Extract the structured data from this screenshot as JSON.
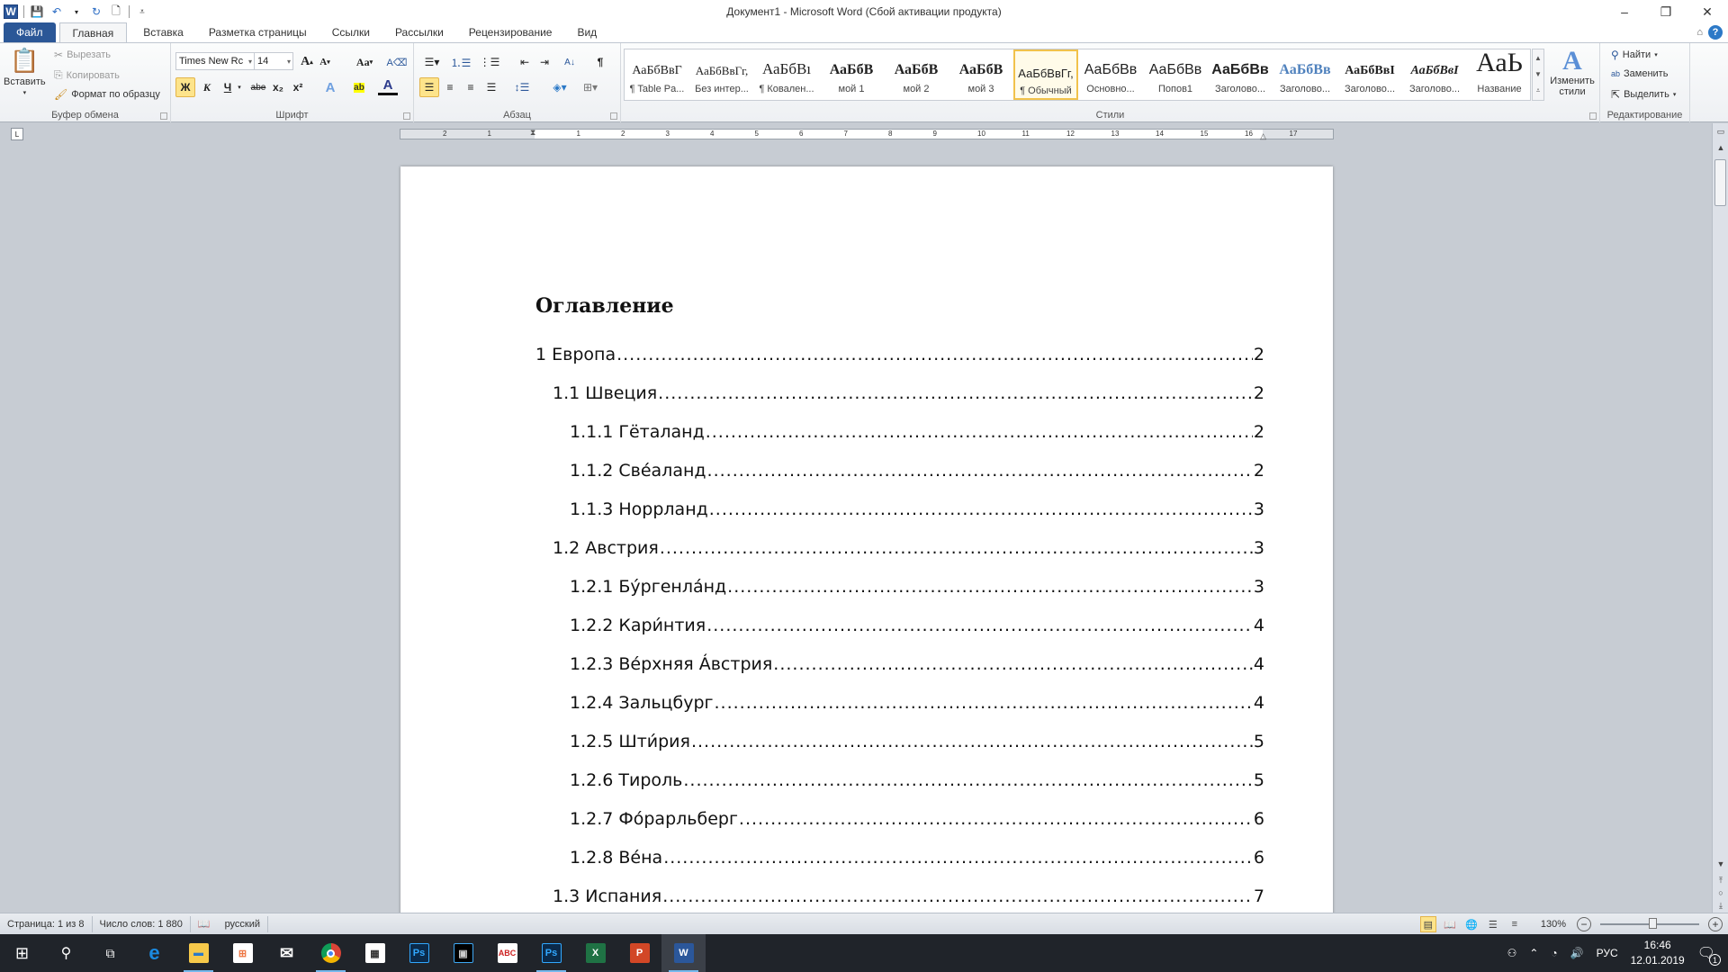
{
  "window": {
    "title": "Документ1 - Microsoft Word (Сбой активации продукта)",
    "controls": {
      "minimize": "–",
      "restore": "❐",
      "close": "✕"
    }
  },
  "qat": {
    "icons": [
      "word-logo",
      "save",
      "undo",
      "redo",
      "new-document",
      "customize"
    ]
  },
  "tabs": [
    {
      "label": "Файл",
      "active": false
    },
    {
      "label": "Главная",
      "active": true
    },
    {
      "label": "Вставка",
      "active": false
    },
    {
      "label": "Разметка страницы",
      "active": false
    },
    {
      "label": "Ссылки",
      "active": false
    },
    {
      "label": "Рассылки",
      "active": false
    },
    {
      "label": "Рецензирование",
      "active": false
    },
    {
      "label": "Вид",
      "active": false
    }
  ],
  "ribbon": {
    "clipboard": {
      "label": "Буфер обмена",
      "paste": "Вставить",
      "cut": "Вырезать",
      "copy": "Копировать",
      "format_painter": "Формат по образцу"
    },
    "font": {
      "label": "Шрифт",
      "font_name": "Times New Rc",
      "font_size": "14",
      "bold": "Ж",
      "italic": "К",
      "underline": "Ч",
      "strikethrough": "abe",
      "subscript": "x₂",
      "superscript": "x²",
      "change_case": "Aa",
      "grow": "A",
      "shrink": "A"
    },
    "paragraph": {
      "label": "Абзац",
      "show_marks": "¶"
    },
    "styles": {
      "label": "Стили",
      "items": [
        {
          "preview": "АаБбВвГ",
          "name": "¶ Table Pa..."
        },
        {
          "preview": "АаБбВвГг,",
          "name": "Без интер..."
        },
        {
          "preview": "АаБбВı",
          "name": "¶ Ковален..."
        },
        {
          "preview": "АаБбВ",
          "name": "мой 1"
        },
        {
          "preview": "АаБбВ",
          "name": "мой 2"
        },
        {
          "preview": "АаБбВ",
          "name": "мой 3"
        },
        {
          "preview": "АаБбВвГг,",
          "name": "¶ Обычный",
          "selected": true
        },
        {
          "preview": "АаБбВв",
          "name": "Основно..."
        },
        {
          "preview": "АаБбВв",
          "name": "Попов1"
        },
        {
          "preview": "АаБбВв",
          "name": "Заголово..."
        },
        {
          "preview": "АаБбВв",
          "name": "Заголово..."
        },
        {
          "preview": "АаБбВвI",
          "name": "Заголово..."
        },
        {
          "preview": "АаБбВвI",
          "name": "Заголово..."
        },
        {
          "preview": "АаЬ",
          "name": "Название"
        }
      ],
      "change_styles": "Изменить стили"
    },
    "editing": {
      "label": "Редактирование",
      "find": "Найти",
      "replace": "Заменить",
      "select": "Выделить"
    }
  },
  "ruler": {
    "left_ticks": [
      "2",
      "1"
    ],
    "ticks": [
      "1",
      "2",
      "3",
      "4",
      "5",
      "6",
      "7",
      "8",
      "9",
      "10",
      "11",
      "12",
      "13",
      "14",
      "15",
      "16",
      "17"
    ]
  },
  "document": {
    "toc_title": "Оглавление",
    "toc": [
      {
        "level": 1,
        "label": "1 Европа",
        "page": "2"
      },
      {
        "level": 2,
        "label": "1.1 Швеция",
        "page": "2"
      },
      {
        "level": 3,
        "label": "1.1.1 Гёталанд",
        "page": "2"
      },
      {
        "level": 3,
        "label": "1.1.2 Свéаланд",
        "page": "2"
      },
      {
        "level": 3,
        "label": "1.1.3 Норрланд",
        "page": "3"
      },
      {
        "level": 2,
        "label": "1.2 Австрия",
        "page": "3"
      },
      {
        "level": 3,
        "label": "1.2.1 Бýргенлáнд",
        "page": "3"
      },
      {
        "level": 3,
        "label": "1.2.2 Кари́нтия",
        "page": "4"
      },
      {
        "level": 3,
        "label": "1.2.3 Вéрхняя Áвстрия",
        "page": "4"
      },
      {
        "level": 3,
        "label": "1.2.4 Зальцбург",
        "page": "4"
      },
      {
        "level": 3,
        "label": "1.2.5 Шти́рия",
        "page": "5"
      },
      {
        "level": 3,
        "label": "1.2.6 Тироль",
        "page": "5"
      },
      {
        "level": 3,
        "label": "1.2.7 Фóрарльберг",
        "page": "6"
      },
      {
        "level": 3,
        "label": "1.2.8 Вéна",
        "page": "6"
      },
      {
        "level": 2,
        "label": "1.3 Испания",
        "page": "7"
      }
    ]
  },
  "statusbar": {
    "page": "Страница: 1 из 8",
    "words": "Число слов: 1 880",
    "language": "русский",
    "zoom": "130%",
    "zoom_percent": 130
  },
  "taskbar": {
    "apps": [
      "start",
      "search",
      "task-view",
      "edge",
      "file-explorer",
      "store",
      "mail",
      "chrome",
      "calculator",
      "photoshop",
      "video-editor",
      "abc-net",
      "photoshop-2",
      "excel",
      "powerpoint",
      "word"
    ],
    "language": "РУС",
    "time": "16:46",
    "date": "12.01.2019",
    "notifications": "1"
  }
}
